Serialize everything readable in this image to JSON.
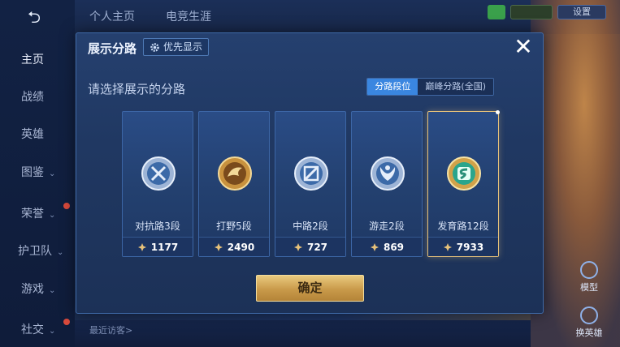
{
  "colors": {
    "accent": "#3a86e0",
    "gold": "#e7c27a"
  },
  "top_tabs": [
    "个人主页",
    "电竞生涯"
  ],
  "sidebar": {
    "items": [
      {
        "label": "主页",
        "chev": false
      },
      {
        "label": "战绩",
        "chev": false
      },
      {
        "label": "英雄",
        "chev": false
      },
      {
        "label": "图鉴",
        "chev": true
      },
      {
        "label": "荣誉",
        "chev": true
      },
      {
        "label": "护卫队",
        "chev": true
      },
      {
        "label": "游戏",
        "chev": true
      },
      {
        "label": "社交",
        "chev": true
      }
    ]
  },
  "top_right": {
    "button_label": "设置"
  },
  "right_side": {
    "model_label": "模型",
    "switch_hero_label": "换英雄"
  },
  "bottom": {
    "recent_visitors": "最近访客>"
  },
  "dialog": {
    "title": "展示分路",
    "priority_label": "优先显示",
    "prompt": "请选择展示的分路",
    "segment": {
      "options": [
        "分路段位",
        "巅峰分路(全国)"
      ],
      "active_index": 0
    },
    "cards": [
      {
        "label": "对抗路3段",
        "points": "1177",
        "icon": "clash-lane-emblem-icon",
        "tier": "silver",
        "selected": false
      },
      {
        "label": "打野5段",
        "points": "2490",
        "icon": "jungle-emblem-icon",
        "tier": "gold",
        "selected": false
      },
      {
        "label": "中路2段",
        "points": "727",
        "icon": "mid-lane-emblem-icon",
        "tier": "silver",
        "selected": false
      },
      {
        "label": "游走2段",
        "points": "869",
        "icon": "roam-emblem-icon",
        "tier": "silver",
        "selected": false
      },
      {
        "label": "发育路12段",
        "points": "7933",
        "icon": "farm-lane-emblem-icon",
        "tier": "jade",
        "selected": true
      }
    ],
    "confirm_label": "确定"
  }
}
